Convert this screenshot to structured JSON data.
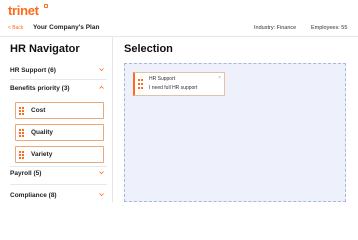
{
  "header": {
    "logo_text": "trinet",
    "back_label": "< Back",
    "plan_title": "Your Company's Plan",
    "industry": "Industry: Finance",
    "employees": "Employees: 55"
  },
  "navigator": {
    "title": "HR Navigator",
    "sections": [
      {
        "label": "HR Support",
        "count": "(6)",
        "expanded": false
      },
      {
        "label": "Benefits priority",
        "count": "(3)",
        "expanded": true
      },
      {
        "label": "Payroll",
        "count": "(5)",
        "expanded": false
      },
      {
        "label": "Compliance",
        "count": "(8)",
        "expanded": false
      }
    ],
    "benefit_items": [
      {
        "label": "Cost"
      },
      {
        "label": "Quality"
      },
      {
        "label": "Variety"
      }
    ]
  },
  "selection": {
    "title": "Selection",
    "cards": [
      {
        "category": "HR Support",
        "text": "I need full HR support",
        "close": "×"
      }
    ]
  },
  "colors": {
    "accent": "#ff6b1a",
    "dropzone_bg": "#eef1fb",
    "dropzone_border": "#a9b6e0"
  }
}
